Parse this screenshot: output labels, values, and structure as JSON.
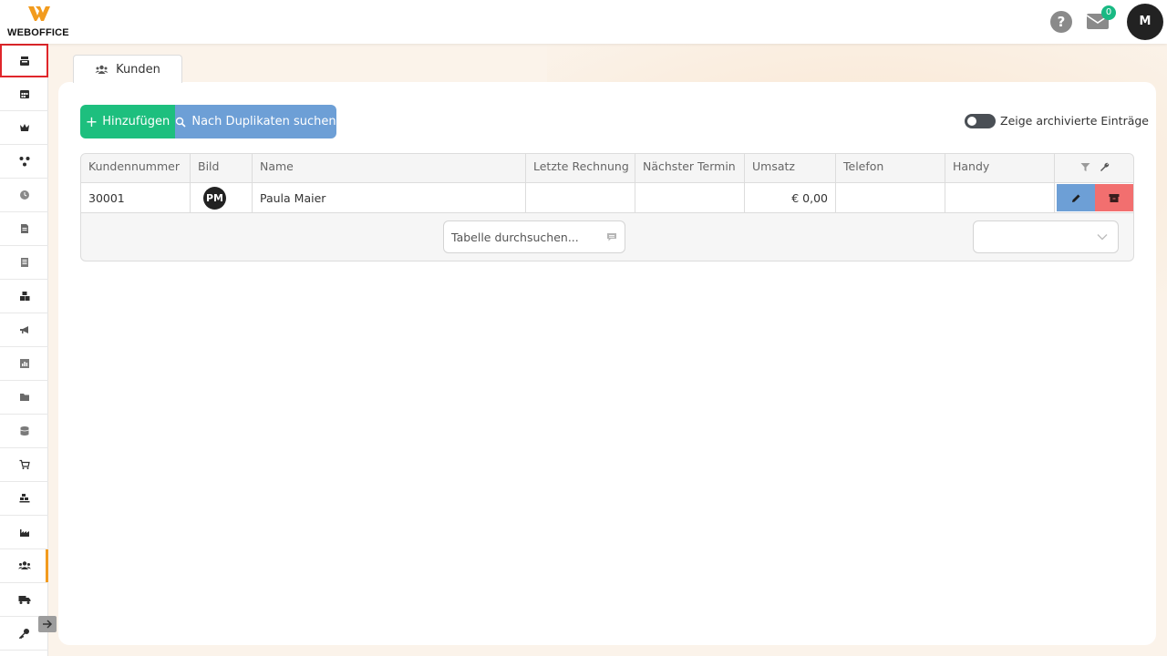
{
  "app": {
    "logo_text": "WEBOFFICE",
    "accent_color": "#f29b1e"
  },
  "header": {
    "help_label": "?",
    "mail_count": "0",
    "user_initial": "M"
  },
  "sidebar": {
    "items": [
      {
        "icon": "cash-register-icon"
      },
      {
        "icon": "calendar-icon"
      },
      {
        "icon": "crown-icon"
      },
      {
        "icon": "network-icon"
      },
      {
        "icon": "clock-icon"
      },
      {
        "icon": "document-icon"
      },
      {
        "icon": "document-list-icon"
      },
      {
        "icon": "boxes-icon"
      },
      {
        "icon": "megaphone-icon"
      },
      {
        "icon": "bar-chart-icon"
      },
      {
        "icon": "folder-icon"
      },
      {
        "icon": "database-icon"
      },
      {
        "icon": "cart-icon"
      },
      {
        "icon": "warehouse-icon"
      },
      {
        "icon": "industry-icon"
      },
      {
        "icon": "users-icon"
      },
      {
        "icon": "truck-icon"
      },
      {
        "icon": "key-icon"
      }
    ],
    "active_index": 15,
    "highlight_index": 0
  },
  "tab": {
    "label": "Kunden"
  },
  "toolbar": {
    "add_label": "Hinzufügen",
    "duplicates_label": "Nach Duplikaten suchen",
    "archive_toggle_label": "Zeige archivierte Einträge"
  },
  "table": {
    "columns": [
      "Kundennummer",
      "Bild",
      "Name",
      "Letzte Rechnung",
      "Nächster Termin",
      "Umsatz",
      "Telefon",
      "Handy"
    ],
    "rows": [
      {
        "kundennummer": "30001",
        "bild": "PM",
        "name": "Paula Maier",
        "letzte_rechnung": "",
        "naechster_termin": "",
        "umsatz": "€ 0,00",
        "telefon": "",
        "handy": ""
      }
    ],
    "search_placeholder": "Tabelle durchsuchen...",
    "page_size_value": ""
  }
}
